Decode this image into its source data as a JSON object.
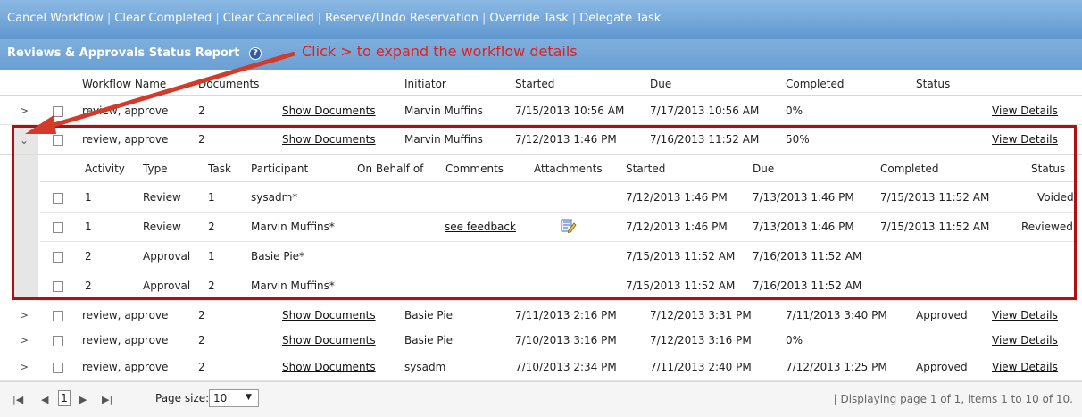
{
  "toolbar": {
    "actions": [
      "Cancel Workflow",
      "Clear Completed",
      "Clear Cancelled",
      "Reserve/Undo Reservation",
      "Override Task",
      "Delegate Task"
    ]
  },
  "report": {
    "title": "Reviews & Approvals Status Report",
    "help_icon": "question-circle-icon",
    "annotation": "Click > to expand the workflow details"
  },
  "columns": {
    "workflow_name": "Workflow Name",
    "documents": "Documents",
    "initiator": "Initiator",
    "started": "Started",
    "due": "Due",
    "completed": "Completed",
    "status": "Status"
  },
  "workflows": [
    {
      "name": "review, approve",
      "docs": "2",
      "show": "Show Documents",
      "initiator": "Marvin Muffins",
      "started": "7/15/2013 10:56 AM",
      "due": "7/17/2013 10:56 AM",
      "completed": "0%",
      "status": "",
      "details": "View Details"
    },
    {
      "name": "review, approve",
      "docs": "2",
      "show": "Show Documents",
      "initiator": "Marvin Muffins",
      "started": "7/12/2013 1:46 PM",
      "due": "7/16/2013 11:52 AM",
      "completed": "50%",
      "status": "",
      "details": "View Details"
    },
    {
      "name": "review, approve",
      "docs": "2",
      "show": "Show Documents",
      "initiator": "Basie Pie",
      "started": "7/11/2013 2:16 PM",
      "due": "7/12/2013 3:31 PM",
      "completed": "7/11/2013 3:40 PM",
      "status": "Approved",
      "details": "View Details"
    },
    {
      "name": "review, approve",
      "docs": "2",
      "show": "Show Documents",
      "initiator": "Basie Pie",
      "started": "7/10/2013 3:16 PM",
      "due": "7/12/2013 3:16 PM",
      "completed": "0%",
      "status": "",
      "details": "View Details"
    },
    {
      "name": "review, approve",
      "docs": "2",
      "show": "Show Documents",
      "initiator": "sysadm",
      "started": "7/10/2013 2:34 PM",
      "due": "7/11/2013 2:40 PM",
      "completed": "7/12/2013 1:25 PM",
      "status": "Approved",
      "details": "View Details"
    }
  ],
  "detail_columns": {
    "activity": "Activity",
    "type": "Type",
    "task": "Task",
    "participant": "Participant",
    "on_behalf_of": "On Behalf of",
    "comments": "Comments",
    "attachments": "Attachments",
    "started": "Started",
    "due": "Due",
    "completed": "Completed",
    "status": "Status"
  },
  "details": [
    {
      "activity": "1",
      "type": "Review",
      "task": "1",
      "participant": "sysadm*",
      "comments": "",
      "attachment_icon": "",
      "started": "7/12/2013 1:46 PM",
      "due": "7/13/2013 1:46 PM",
      "completed": "7/15/2013 11:52 AM",
      "status": "Voided"
    },
    {
      "activity": "1",
      "type": "Review",
      "task": "2",
      "participant": "Marvin Muffins*",
      "comments": "see feedback",
      "attachment_icon": "edit-document-icon",
      "started": "7/12/2013 1:46 PM",
      "due": "7/13/2013 1:46 PM",
      "completed": "7/15/2013 11:52 AM",
      "status": "Reviewed"
    },
    {
      "activity": "2",
      "type": "Approval",
      "task": "1",
      "participant": "Basie Pie*",
      "comments": "",
      "attachment_icon": "",
      "started": "7/15/2013 11:52 AM",
      "due": "7/16/2013 11:52 AM",
      "completed": "",
      "status": ""
    },
    {
      "activity": "2",
      "type": "Approval",
      "task": "2",
      "participant": "Marvin Muffins*",
      "comments": "",
      "attachment_icon": "",
      "started": "7/15/2013 11:52 AM",
      "due": "7/16/2013 11:52 AM",
      "completed": "",
      "status": ""
    }
  ],
  "pager": {
    "current_page": "1",
    "page_size_label": "Page size:",
    "page_size": "10",
    "info": "| Displaying page 1 of 1, items 1 to 10 of 10."
  },
  "colors": {
    "toolbar": "#6aa0d4",
    "annotation": "#e02020",
    "highlight_box": "#b01010"
  }
}
